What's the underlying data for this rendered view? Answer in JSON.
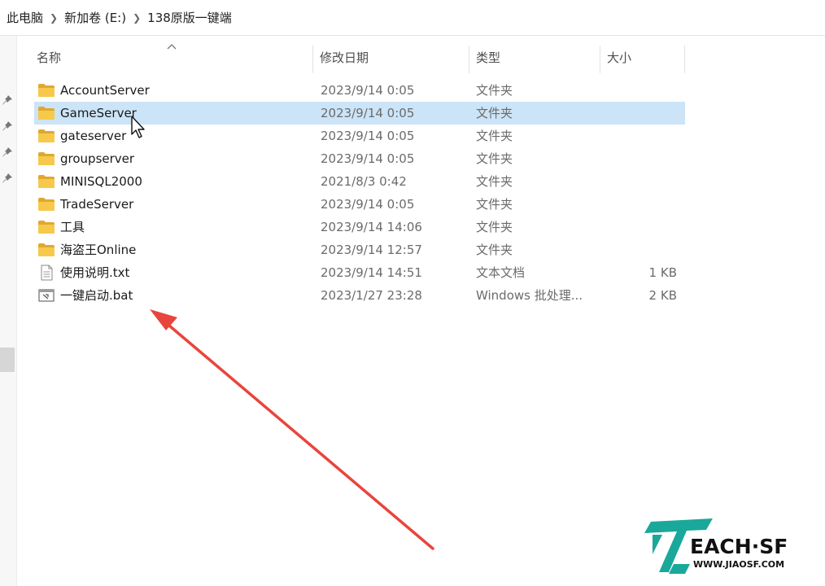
{
  "breadcrumb": [
    "此电脑",
    "新加卷 (E:)",
    "138原版一键端"
  ],
  "columns": {
    "name": "名称",
    "date": "修改日期",
    "type": "类型",
    "size": "大小"
  },
  "files": [
    {
      "name": "AccountServer",
      "date": "2023/9/14 0:05",
      "type": "文件夹",
      "size": "",
      "icon": "folder-icon"
    },
    {
      "name": "GameServer",
      "date": "2023/9/14 0:05",
      "type": "文件夹",
      "size": "",
      "icon": "folder-icon",
      "selected": true
    },
    {
      "name": "gateserver",
      "date": "2023/9/14 0:05",
      "type": "文件夹",
      "size": "",
      "icon": "folder-icon"
    },
    {
      "name": "groupserver",
      "date": "2023/9/14 0:05",
      "type": "文件夹",
      "size": "",
      "icon": "folder-icon"
    },
    {
      "name": "MINISQL2000",
      "date": "2021/8/3 0:42",
      "type": "文件夹",
      "size": "",
      "icon": "folder-icon"
    },
    {
      "name": "TradeServer",
      "date": "2023/9/14 0:05",
      "type": "文件夹",
      "size": "",
      "icon": "folder-icon"
    },
    {
      "name": "工具",
      "date": "2023/9/14 14:06",
      "type": "文件夹",
      "size": "",
      "icon": "folder-icon"
    },
    {
      "name": "海盗王Online",
      "date": "2023/9/14 12:57",
      "type": "文件夹",
      "size": "",
      "icon": "folder-icon"
    },
    {
      "name": "使用说明.txt",
      "date": "2023/9/14 14:51",
      "type": "文本文档",
      "size": "1 KB",
      "icon": "text-file-icon"
    },
    {
      "name": "一键启动.bat",
      "date": "2023/1/27 23:28",
      "type": "Windows 批处理...",
      "size": "2 KB",
      "icon": "batch-file-icon"
    }
  ],
  "watermark": {
    "word": "EACH·SF",
    "url": "WWW.JIAOSF.COM"
  },
  "colors": {
    "selection": "#cce4f7",
    "folder": "#f6c94c",
    "arrow": "#e8453c",
    "logo_teal": "#1aa89a"
  }
}
